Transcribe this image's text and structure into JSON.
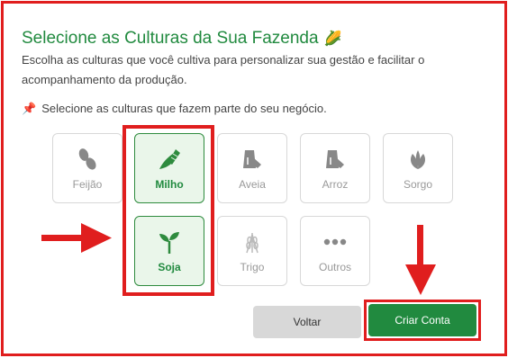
{
  "header": {
    "title": "Selecione as Culturas da Sua Fazenda",
    "title_emoji": "🌽",
    "description": "Escolha as culturas que você cultiva para personalizar sua gestão e facilitar o acompanhamento da produção.",
    "hint_icon": "📌",
    "hint": "Selecione as culturas que fazem parte do seu negócio."
  },
  "crops": [
    {
      "label": "Feijão",
      "icon": "bean-icon",
      "selected": false
    },
    {
      "label": "Milho",
      "icon": "corn-icon",
      "selected": true
    },
    {
      "label": "Aveia",
      "icon": "grain-sack-icon",
      "selected": false
    },
    {
      "label": "Arroz",
      "icon": "grain-sack-icon",
      "selected": false
    },
    {
      "label": "Sorgo",
      "icon": "leaf-icon",
      "selected": false
    },
    {
      "label": "Soja",
      "icon": "seedling-icon",
      "selected": true
    },
    {
      "label": "Trigo",
      "icon": "wheat-icon",
      "selected": false
    },
    {
      "label": "Outros",
      "icon": "dots-icon",
      "selected": false
    }
  ],
  "buttons": {
    "back": "Voltar",
    "create": "Criar Conta"
  },
  "colors": {
    "accent": "#218a3f",
    "highlight": "#e01e1e",
    "selected_bg": "#eaf6ea"
  }
}
